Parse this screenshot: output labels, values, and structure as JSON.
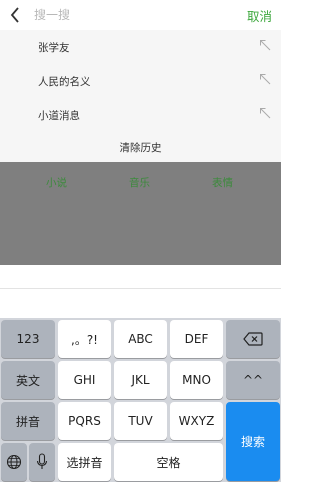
{
  "search": {
    "placeholder": "搜一搜",
    "cancel_label": "取消"
  },
  "history": {
    "items": [
      {
        "label": "张学友"
      },
      {
        "label": "人民的名义"
      },
      {
        "label": "小道消息"
      }
    ],
    "clear_label": "清除历史"
  },
  "categories": [
    {
      "label": "小说"
    },
    {
      "label": "音乐"
    },
    {
      "label": "表情"
    }
  ],
  "keyboard": {
    "row1": {
      "k0": "123",
      "k1": ",。?!",
      "k2": "ABC",
      "k3": "DEF"
    },
    "row2": {
      "k0": "英文",
      "k1": "GHI",
      "k2": "JKL",
      "k3": "MNO",
      "k4": "^^"
    },
    "row3": {
      "k0": "拼音",
      "k1": "PQRS",
      "k2": "TUV",
      "k3": "WXYZ"
    },
    "row4": {
      "k2": "选拼音",
      "k3": "空格"
    },
    "search_label": "搜索",
    "icons": [
      "back-chevron-icon",
      "backspace-icon",
      "globe-icon",
      "microphone-icon",
      "north-west-arrow-icon"
    ]
  },
  "colors": {
    "accent_green": "#3da83d",
    "category_green": "#3c8a3c",
    "overlay_gray": "#7f7f7f",
    "keyboard_bg": "#d2d5db",
    "search_key_blue": "#1a8cf0"
  }
}
